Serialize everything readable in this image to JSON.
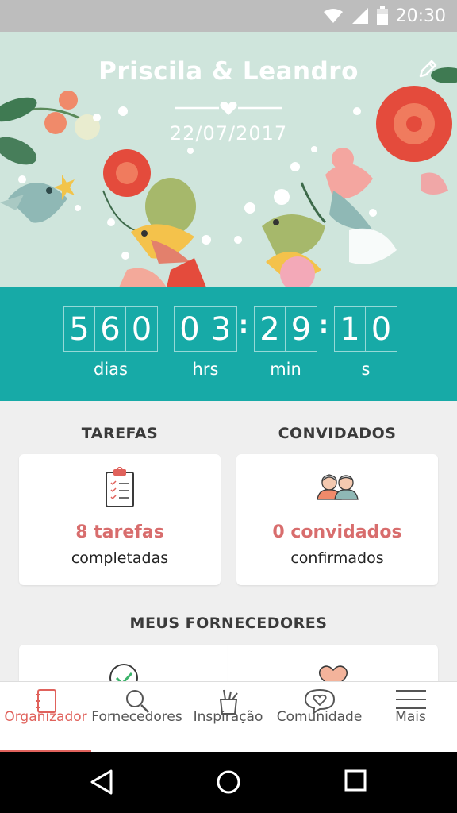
{
  "status_bar": {
    "time": "20:30"
  },
  "header": {
    "couple_names": "Priscila & Leandro",
    "date": "22/07/2017"
  },
  "countdown": {
    "days": "560",
    "hours": "03",
    "minutes": "29",
    "seconds": "10",
    "days_label": "dias",
    "hours_label": "hrs",
    "minutes_label": "min",
    "seconds_label": "s"
  },
  "tasks": {
    "title": "TAREFAS",
    "count": "8 tarefas",
    "status": "completadas"
  },
  "guests": {
    "title": "CONVIDADOS",
    "count": "0 convidados",
    "status": "confirmados"
  },
  "vendors": {
    "title": "MEUS FORNECEDORES"
  },
  "bottom_nav": {
    "items": [
      {
        "label": "Organizador",
        "icon": "notebook-icon",
        "active": true
      },
      {
        "label": "Fornecedores",
        "icon": "search-icon"
      },
      {
        "label": "Inspiração",
        "icon": "pencil-cup-icon"
      },
      {
        "label": "Comunidade",
        "icon": "chat-heart-icon"
      },
      {
        "label": "Mais",
        "icon": "menu-icon"
      }
    ]
  },
  "colors": {
    "teal": "#17aaa7",
    "coral": "#d86d6d",
    "hero_bg": "#cfe5dc"
  }
}
